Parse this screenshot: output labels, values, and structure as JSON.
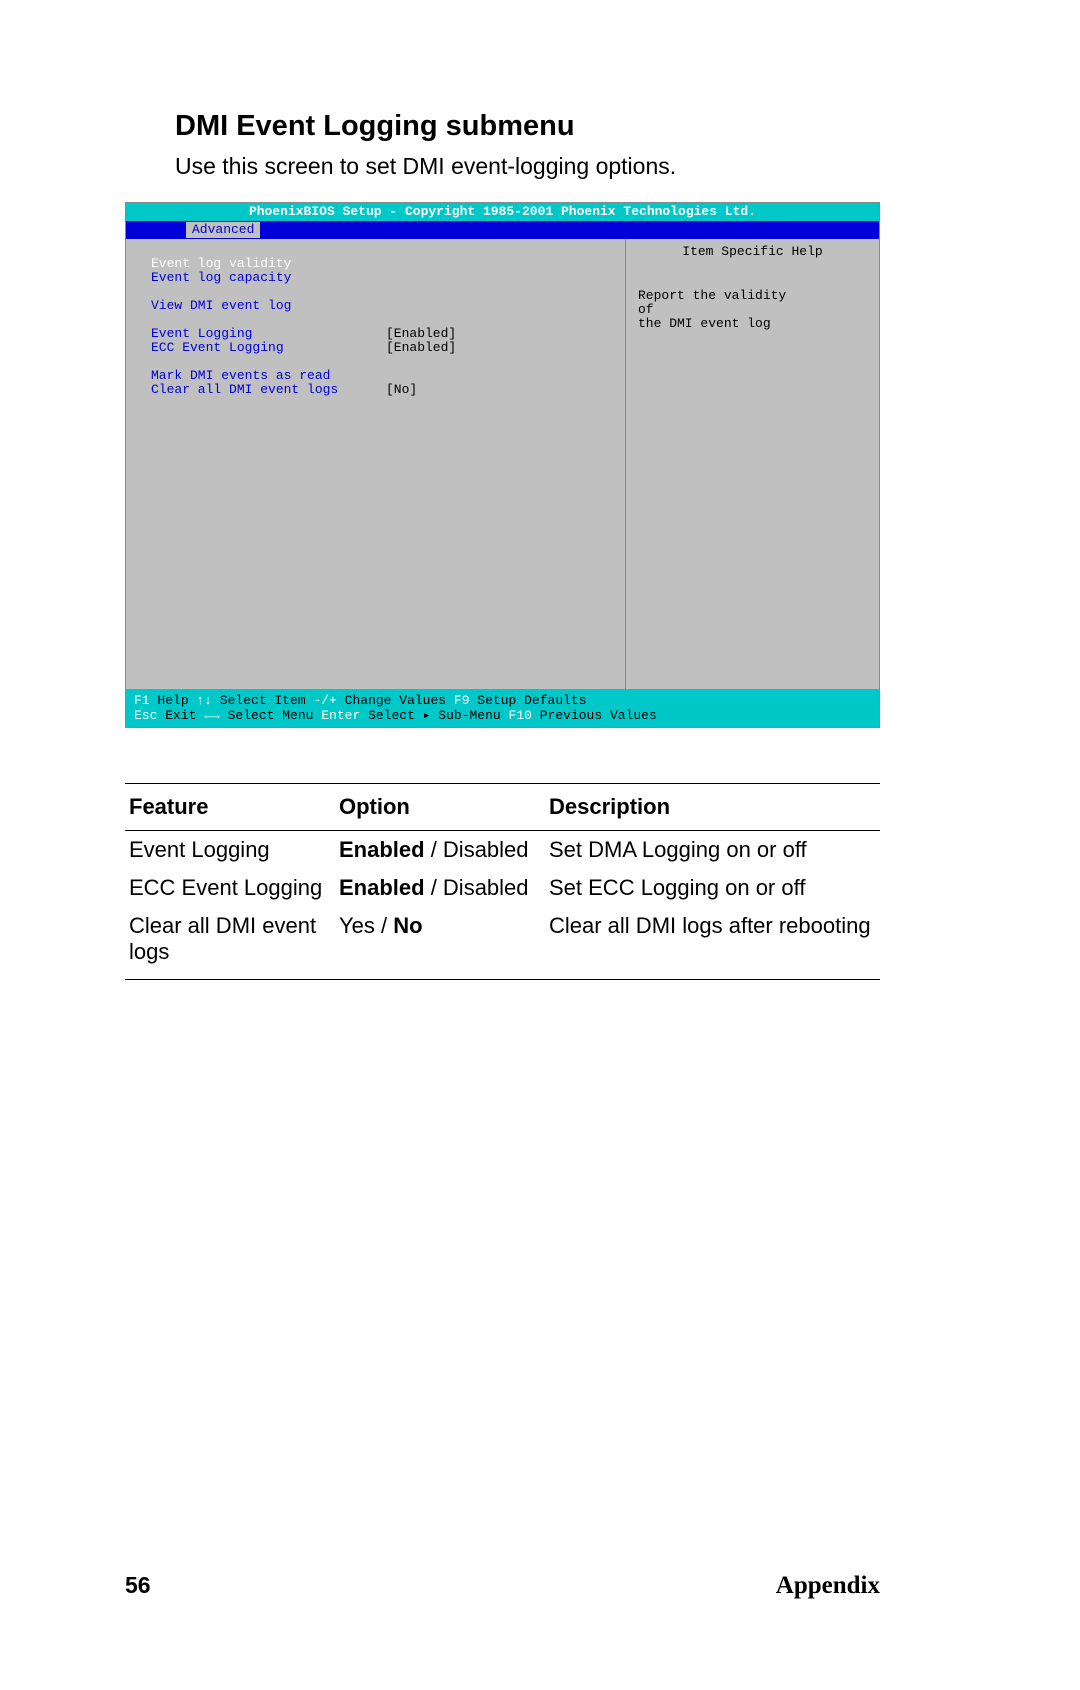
{
  "heading": "DMI Event Logging submenu",
  "subtitle": "Use this screen to set DMI event-logging options.",
  "bios": {
    "title": "PhoenixBIOS Setup - Copyright 1985-2001 Phoenix Technologies Ltd.",
    "tab": "Advanced",
    "items": {
      "event_log_validity": "Event log validity",
      "event_log_capacity": "Event log capacity",
      "view_dmi": "View DMI event log",
      "event_logging": "Event Logging",
      "event_logging_val": "[Enabled]",
      "ecc_logging": "ECC Event Logging",
      "ecc_logging_val": "[Enabled]",
      "mark_read": "Mark DMI events as read",
      "clear_all": "Clear all DMI event logs",
      "clear_all_val": "[No]"
    },
    "help_title": "Item Specific Help",
    "help_line1": "Report the validity",
    "help_line2": "of",
    "help_line3": "the DMI event log",
    "footer": {
      "f1": "F1",
      "f1t": " Help  ",
      "ud": "↑↓",
      "udt": " Select Item ",
      "pm": "-/+",
      "pmt": "  Change Values   ",
      "f9": "F9",
      "f9t": "  Setup Defaults",
      "esc": "Esc",
      "esct": " Exit ",
      "lr": "←→",
      "lrt": " Select Menu ",
      "ent": "Enter",
      "entt": " Select ▸ Sub-Menu",
      "f10": "F10",
      "f10t": " Previous Values"
    }
  },
  "table": {
    "headers": {
      "feature": "Feature",
      "option": "Option",
      "description": "Description"
    },
    "rows": [
      {
        "feature": "Event Logging",
        "opt_bold": "Enabled",
        "opt_sep": " / ",
        "opt_plain": "Disabled",
        "desc": "Set DMA Logging on or off"
      },
      {
        "feature": "ECC Event Logging",
        "opt_bold": "Enabled",
        "opt_sep": " / ",
        "opt_plain": "Disabled",
        "desc": "Set ECC Logging on or off"
      },
      {
        "feature": "Clear all DMI event logs",
        "opt_plain_pre": "Yes",
        "opt_sep": " / ",
        "opt_bold": "No",
        "desc": "Clear all DMI logs after rebooting"
      }
    ]
  },
  "page_number": "56",
  "section": "Appendix"
}
